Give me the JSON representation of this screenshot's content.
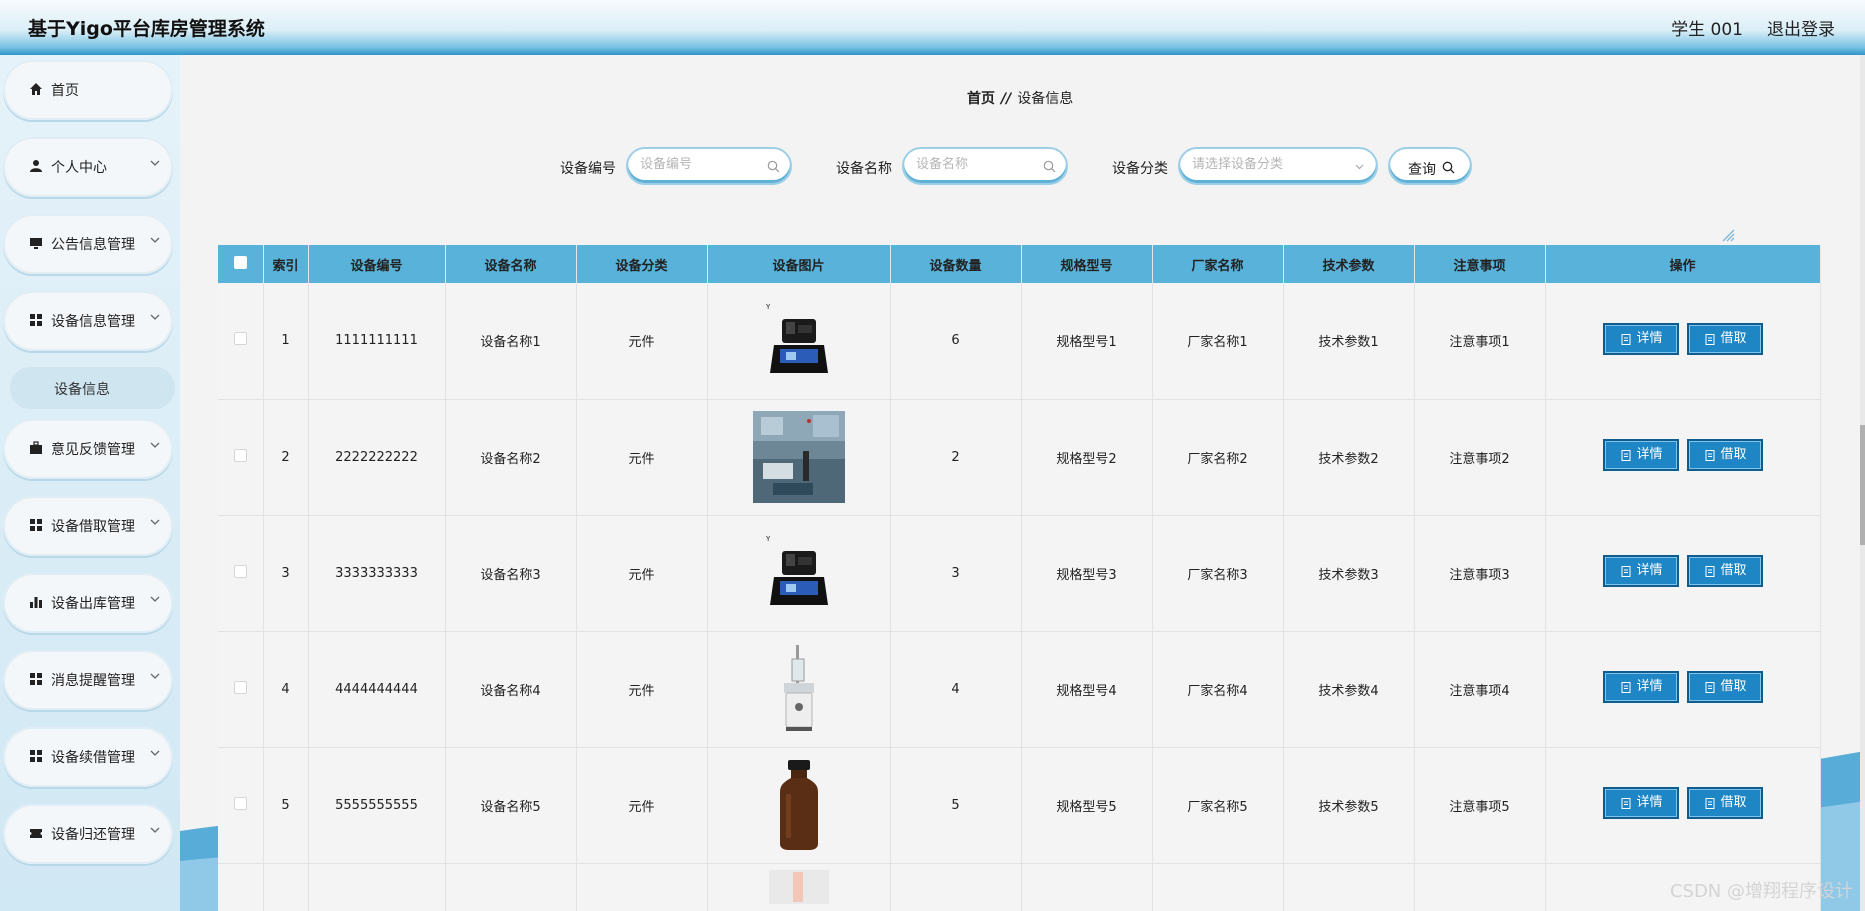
{
  "header": {
    "title": "基于Yigo平台库房管理系统",
    "user": "学生 001",
    "logout": "退出登录"
  },
  "sidebar": {
    "items": [
      {
        "label": "首页",
        "icon": "home-icon"
      },
      {
        "label": "个人中心",
        "icon": "user-icon"
      },
      {
        "label": "公告信息管理",
        "icon": "monitor-icon"
      },
      {
        "label": "设备信息管理",
        "icon": "grid-icon"
      },
      {
        "label": "意见反馈管理",
        "icon": "briefcase-icon"
      },
      {
        "label": "设备借取管理",
        "icon": "grid-icon"
      },
      {
        "label": "设备出库管理",
        "icon": "bar-chart-icon"
      },
      {
        "label": "消息提醒管理",
        "icon": "grid-icon"
      },
      {
        "label": "设备续借管理",
        "icon": "grid-icon"
      },
      {
        "label": "设备归还管理",
        "icon": "ticket-icon"
      }
    ],
    "active_sub": "设备信息"
  },
  "breadcrumb": {
    "home": "首页",
    "sep": "//",
    "current": "设备信息"
  },
  "search": {
    "code_label": "设备编号",
    "code_placeholder": "设备编号",
    "name_label": "设备名称",
    "name_placeholder": "设备名称",
    "category_label": "设备分类",
    "category_placeholder": "请选择设备分类",
    "query": "查询"
  },
  "table": {
    "headers": [
      "索引",
      "设备编号",
      "设备名称",
      "设备分类",
      "设备图片",
      "设备数量",
      "规格型号",
      "厂家名称",
      "技术参数",
      "注意事项",
      "操作"
    ],
    "rows": [
      {
        "idx": "1",
        "code": "1111111111",
        "name": "设备名称1",
        "category": "元件",
        "image": "instrument-case",
        "qty": "6",
        "spec": "规格型号1",
        "maker": "厂家名称1",
        "params": "技术参数1",
        "notes": "注意事项1"
      },
      {
        "idx": "2",
        "code": "2222222222",
        "name": "设备名称2",
        "category": "元件",
        "image": "lab-photo",
        "qty": "2",
        "spec": "规格型号2",
        "maker": "厂家名称2",
        "params": "技术参数2",
        "notes": "注意事项2"
      },
      {
        "idx": "3",
        "code": "3333333333",
        "name": "设备名称3",
        "category": "元件",
        "image": "instrument-case",
        "qty": "3",
        "spec": "规格型号3",
        "maker": "厂家名称3",
        "params": "技术参数3",
        "notes": "注意事项3"
      },
      {
        "idx": "4",
        "code": "4444444444",
        "name": "设备名称4",
        "category": "元件",
        "image": "lab-apparatus",
        "qty": "4",
        "spec": "规格型号4",
        "maker": "厂家名称4",
        "params": "技术参数4",
        "notes": "注意事项4"
      },
      {
        "idx": "5",
        "code": "5555555555",
        "name": "设备名称5",
        "category": "元件",
        "image": "brown-bottle",
        "qty": "5",
        "spec": "规格型号5",
        "maker": "厂家名称5",
        "params": "技术参数5",
        "notes": "注意事项5"
      }
    ],
    "detail_btn": "详情",
    "borrow_btn": "借取"
  },
  "watermark": "CSDN @增翔程序设计",
  "colors": {
    "header_accent": "#2f96c8",
    "table_header": "#58b2d9",
    "button": "#1f86c6"
  }
}
